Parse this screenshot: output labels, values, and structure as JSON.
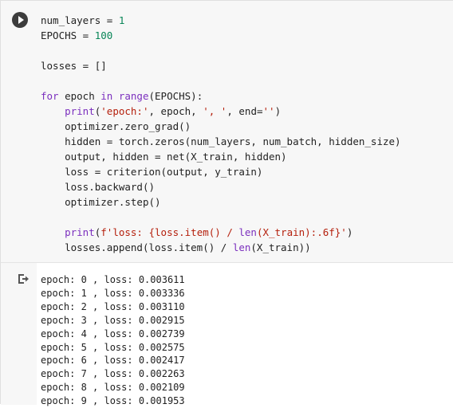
{
  "code_lines": [
    [
      "num_layers = ",
      "1"
    ],
    [
      "EPOCHS = ",
      "100"
    ],
    [
      "losses = []"
    ],
    [
      "for",
      " epoch ",
      "in",
      " ",
      "range",
      "(EPOCHS):"
    ],
    [
      "print",
      "(",
      "'epoch:'",
      ", epoch, ",
      "', '",
      ", end=",
      "''",
      ")"
    ],
    [
      "optimizer.zero_grad()"
    ],
    [
      "hidden = torch.zeros(num_layers, num_batch, hidden_size)"
    ],
    [
      "output, hidden = net(X_train, hidden)"
    ],
    [
      "loss = criterion(output, y_train)"
    ],
    [
      "loss.backward()"
    ],
    [
      "optimizer.step()"
    ],
    [
      "print",
      "(",
      "f'loss: {loss.item() / ",
      "len",
      "(X_train):.6f}'",
      ")"
    ],
    [
      "losses.append(loss.item() / ",
      "len",
      "(X_train))"
    ]
  ],
  "output_lines": [
    "epoch: 0 , loss: 0.003611",
    "epoch: 1 , loss: 0.003336",
    "epoch: 2 , loss: 0.003110",
    "epoch: 3 , loss: 0.002915",
    "epoch: 4 , loss: 0.002739",
    "epoch: 5 , loss: 0.002575",
    "epoch: 6 , loss: 0.002417",
    "epoch: 7 , loss: 0.002263",
    "epoch: 8 , loss: 0.002109",
    "epoch: 9 , loss: 0.001953"
  ],
  "colors": {
    "keyword": "#7b2fbe",
    "number": "#098658",
    "string": "#b5200d",
    "code_bg": "#f7f7f7"
  },
  "icons": {
    "run": "play-circle-icon",
    "output": "output-arrow-icon"
  }
}
